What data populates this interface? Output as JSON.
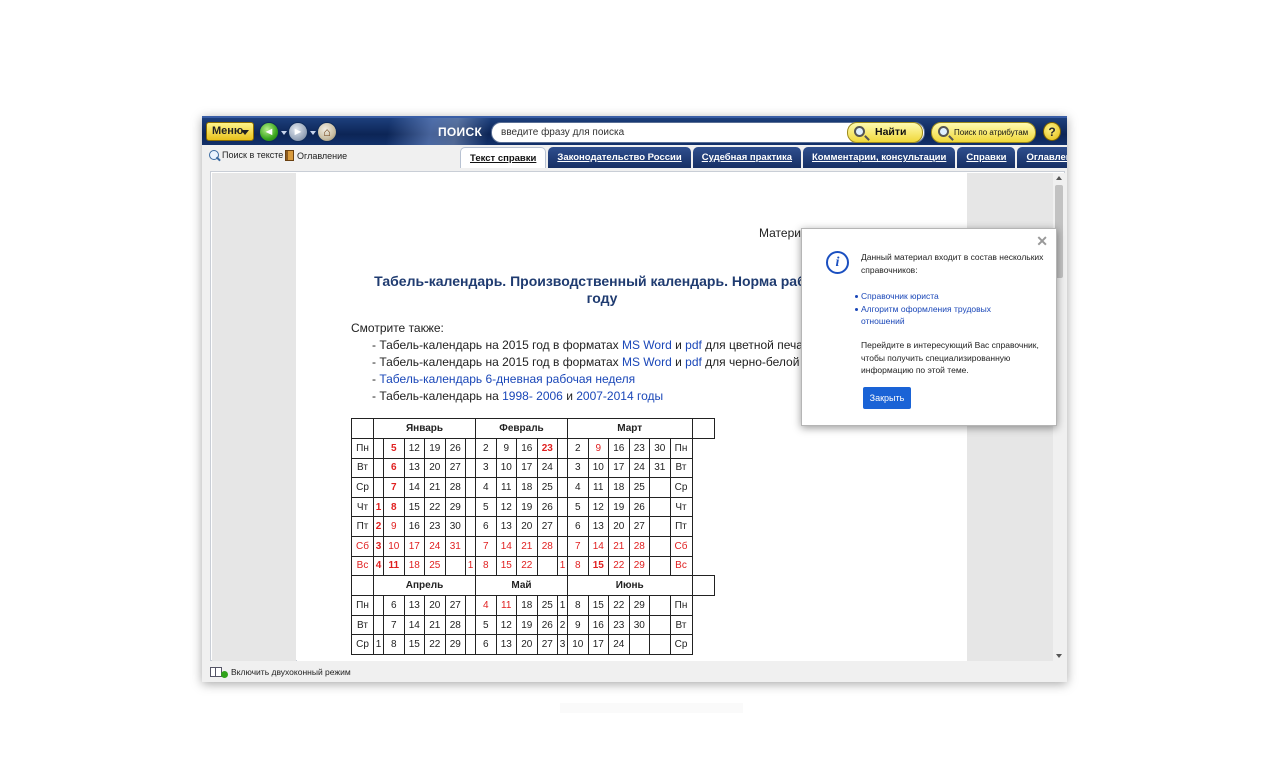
{
  "toolbar": {
    "menu_label": "Меню",
    "back_glyph": "◄",
    "forward_glyph": "►",
    "home_glyph": "⌂",
    "search_label": "ПОИСК",
    "search_value": "введите фразу для поиска",
    "find_label": "Найти",
    "attr_search_label": "Поиск по атрибутам",
    "help_glyph": "?"
  },
  "secondbar": {
    "search_in_text": "Поиск в тексте",
    "contents": "Оглавление",
    "tabs": [
      {
        "label": "Текст справки",
        "active": true
      },
      {
        "label": "Законодательство России"
      },
      {
        "label": "Судебная практика"
      },
      {
        "label": "Комментарии, консультации"
      },
      {
        "label": "Справки"
      },
      {
        "label": "Оглавление"
      }
    ]
  },
  "doc": {
    "note": "Матери",
    "title_line1": "Табель-календарь. Производственный календарь. Норма рабоче",
    "title_line2": "году",
    "see_also": "Смотрите также:",
    "items": [
      {
        "pre": "- Табель-календарь на 2015 год в форматах ",
        "l1": "MS Word",
        "mid": " и ",
        "l2": "pdf",
        "post": " для цветной печати,"
      },
      {
        "pre": "- Табель-календарь на 2015 год в форматах ",
        "l1": "MS Word",
        "mid": " и ",
        "l2": "pdf",
        "post": " для черно-белой печа"
      },
      {
        "pre": "- ",
        "l1": "Табель-календарь 6-дневная рабочая неделя",
        "mid": "",
        "l2": "",
        "post": ""
      },
      {
        "pre": "- Табель-календарь на ",
        "l1": "1998- 2006",
        "mid": " и ",
        "l2": "2007-2014 годы",
        "post": ""
      }
    ]
  },
  "calendar": {
    "q1": {
      "months": [
        "Январь",
        "Февраль",
        "Март"
      ],
      "rows": [
        [
          "Пн",
          "",
          "5",
          "12",
          "19",
          "26",
          "",
          "2",
          "9",
          "16",
          "23",
          "",
          "2",
          "9",
          "16",
          "23",
          "30",
          "Пн"
        ],
        [
          "Вт",
          "",
          "6",
          "13",
          "20",
          "27",
          "",
          "3",
          "10",
          "17",
          "24",
          "",
          "3",
          "10",
          "17",
          "24",
          "31",
          "Вт"
        ],
        [
          "Ср",
          "",
          "7",
          "14",
          "21",
          "28",
          "",
          "4",
          "11",
          "18",
          "25",
          "",
          "4",
          "11",
          "18",
          "25",
          "",
          "Ср"
        ],
        [
          "Чт",
          "1",
          "8",
          "15",
          "22",
          "29",
          "",
          "5",
          "12",
          "19",
          "26",
          "",
          "5",
          "12",
          "19",
          "26",
          "",
          "Чт"
        ],
        [
          "Пт",
          "2",
          "9",
          "16",
          "23",
          "30",
          "",
          "6",
          "13",
          "20",
          "27",
          "",
          "6",
          "13",
          "20",
          "27",
          "",
          "Пт"
        ],
        [
          "Сб",
          "3",
          "10",
          "17",
          "24",
          "31",
          "",
          "7",
          "14",
          "21",
          "28",
          "",
          "7",
          "14",
          "21",
          "28",
          "",
          "Сб"
        ],
        [
          "Вс",
          "4",
          "11",
          "18",
          "25",
          "",
          "1",
          "8",
          "15",
          "22",
          "",
          "1",
          "8",
          "15",
          "22",
          "29",
          "",
          "Вс"
        ]
      ]
    },
    "q2": {
      "months": [
        "Апрель",
        "Май",
        "Июнь"
      ],
      "rows": [
        [
          "Пн",
          "",
          "6",
          "13",
          "20",
          "27",
          "",
          "4",
          "11",
          "18",
          "25",
          "1",
          "8",
          "15",
          "22",
          "29",
          "",
          "Пн"
        ],
        [
          "Вт",
          "",
          "7",
          "14",
          "21",
          "28",
          "",
          "5",
          "12",
          "19",
          "26",
          "2",
          "9",
          "16",
          "23",
          "30",
          "",
          "Вт"
        ],
        [
          "Ср",
          "1",
          "8",
          "15",
          "22",
          "29",
          "",
          "6",
          "13",
          "20",
          "27",
          "3",
          "10",
          "17",
          "24",
          "",
          "",
          "Ср"
        ]
      ]
    },
    "red_color": "#e02020"
  },
  "popup": {
    "close_glyph": "✕",
    "info_glyph": "i",
    "line1": "Данный материал входит в состав нескольких",
    "line2": "справочников:",
    "links": [
      "Справочник юриста",
      "Алгоритм оформления трудовых",
      "отношений"
    ],
    "hint1": "Перейдите в интересующий Вас справочник,",
    "hint2": "чтобы получить специализированную",
    "hint3": "информацию по этой теме.",
    "close_button": "Закрыть"
  },
  "statusbar": {
    "dual_mode": "Включить двухоконный режим"
  }
}
